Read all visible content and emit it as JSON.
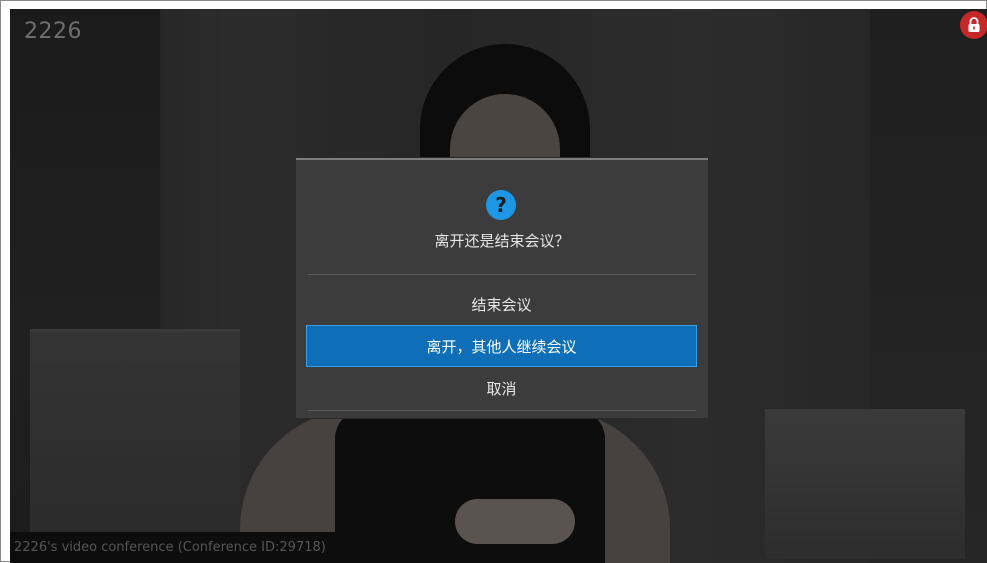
{
  "room": {
    "id": "2226"
  },
  "status": {
    "lock_icon": "lock-icon",
    "lock_color": "#c62828"
  },
  "caption": {
    "text": "2226's video conference (Conference ID:29718)"
  },
  "dialog": {
    "icon": "?",
    "icon_color": "#1e96e6",
    "title": "离开还是结束会议？",
    "options": [
      {
        "label": "结束会议",
        "selected": false
      },
      {
        "label": "离开，其他人继续会议",
        "selected": true
      },
      {
        "label": "取消",
        "selected": false
      }
    ],
    "accent": "#0e6fb8"
  }
}
